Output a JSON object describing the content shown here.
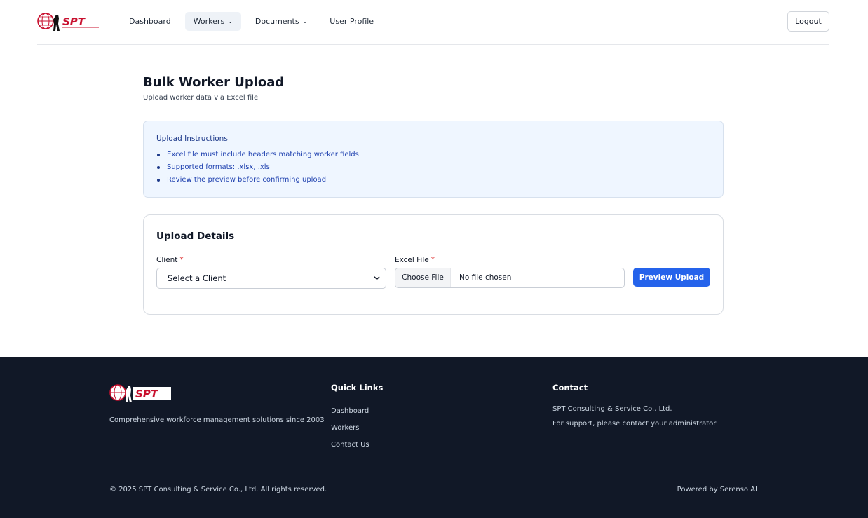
{
  "header": {
    "logo_text": "SPT",
    "nav": [
      {
        "label": "Dashboard",
        "has_dropdown": false
      },
      {
        "label": "Workers",
        "has_dropdown": true,
        "active": true
      },
      {
        "label": "Documents",
        "has_dropdown": true
      },
      {
        "label": "User Profile",
        "has_dropdown": false
      }
    ],
    "logout_label": "Logout"
  },
  "page": {
    "title": "Bulk Worker Upload",
    "subtitle": "Upload worker data via Excel file"
  },
  "instructions": {
    "title": "Upload Instructions",
    "items": [
      "Excel file must include headers matching worker fields",
      "Supported formats: .xlsx, .xls",
      "Review the preview before confirming upload"
    ]
  },
  "upload": {
    "title": "Upload Details",
    "client_label": "Client",
    "client_value": "Select a Client",
    "file_label": "Excel File",
    "required_mark": "*",
    "choose_file_label": "Choose File",
    "file_status": "No file chosen",
    "preview_button": "Preview Upload"
  },
  "footer": {
    "logo_text": "SPT",
    "description": "Comprehensive workforce management solutions since 2003",
    "quick_links_title": "Quick Links",
    "quick_links": [
      "Dashboard",
      "Workers",
      "Contact Us"
    ],
    "contact_title": "Contact",
    "contact_lines": [
      "SPT Consulting & Service Co., Ltd.",
      "For support, please contact your administrator"
    ],
    "copyright": "© 2025 SPT Consulting & Service Co., Ltd. All rights reserved.",
    "powered_by": "Powered by Serenso AI"
  },
  "colors": {
    "primary": "#2563eb",
    "brand_red": "#c8102e",
    "footer_bg": "#111827",
    "instructions_bg": "#eff6ff"
  }
}
